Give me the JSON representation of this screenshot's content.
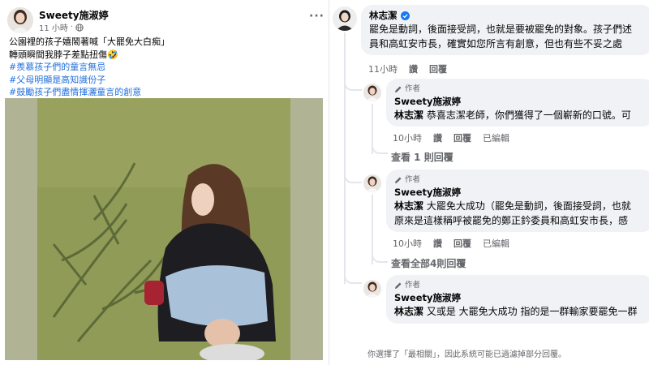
{
  "post": {
    "author": "Sweety施淑婷",
    "time": "11 小時",
    "text_lines": [
      "公園裡的孩子嬉鬧著喊「大罷免大白痴」",
      "轉頭瞬間我脖子差點扭傷🤣"
    ],
    "hashtags": [
      "#羨慕孩子們的童言無忌",
      "#父母明顯是高知識份子",
      "#鼓勵孩子們盡情揮灑童言的創意"
    ],
    "more_icon": "more-dots-icon",
    "privacy_icon": "globe-icon"
  },
  "comments": {
    "main": {
      "author": "林志潔",
      "verified_icon": "verified-badge-icon",
      "line1": "罷免是動詞，後面接受詞，也就是要被罷免的對象。孩子們述",
      "line2": "員和高虹安市長，確實如您所言有創意，但也有些不妥之處",
      "time": "11小時",
      "like": "讚",
      "reply": "回覆"
    },
    "replies": [
      {
        "badge": "作者",
        "author": "Sweety施淑婷",
        "mention": "林志潔",
        "line1": "恭喜志潔老師，你們獲得了一個嶄新的口號。可",
        "line2": "",
        "time": "10小時",
        "like": "讚",
        "reply": "回覆",
        "edited": "已編輯",
        "view_more": "查看 1 則回覆"
      },
      {
        "badge": "作者",
        "author": "Sweety施淑婷",
        "mention": "林志潔",
        "line1": "大罷免大成功（罷免是動詞，後面接受詞，也就",
        "line2": "原來是這樣稱呼被罷免的鄭正鈐委員和高虹安市長，感",
        "time": "10小時",
        "like": "讚",
        "reply": "回覆",
        "edited": "已編輯",
        "view_more": "查看全部4則回覆"
      },
      {
        "badge": "作者",
        "author": "Sweety施淑婷",
        "mention": "林志潔",
        "line1": "又或是 大罷免大成功 指的是一群輸家要罷免一群",
        "line2": "",
        "time": "",
        "like": "",
        "reply": "",
        "edited": "",
        "view_more": ""
      }
    ],
    "filter_note": "你選擇了「最相關」，因此系統可能已過濾掉部分回覆。"
  },
  "colors": {
    "hashtag": "#216fdb",
    "bubble": "#f0f2f5",
    "secondary_text": "#65676b",
    "verified": "#1877f2"
  }
}
